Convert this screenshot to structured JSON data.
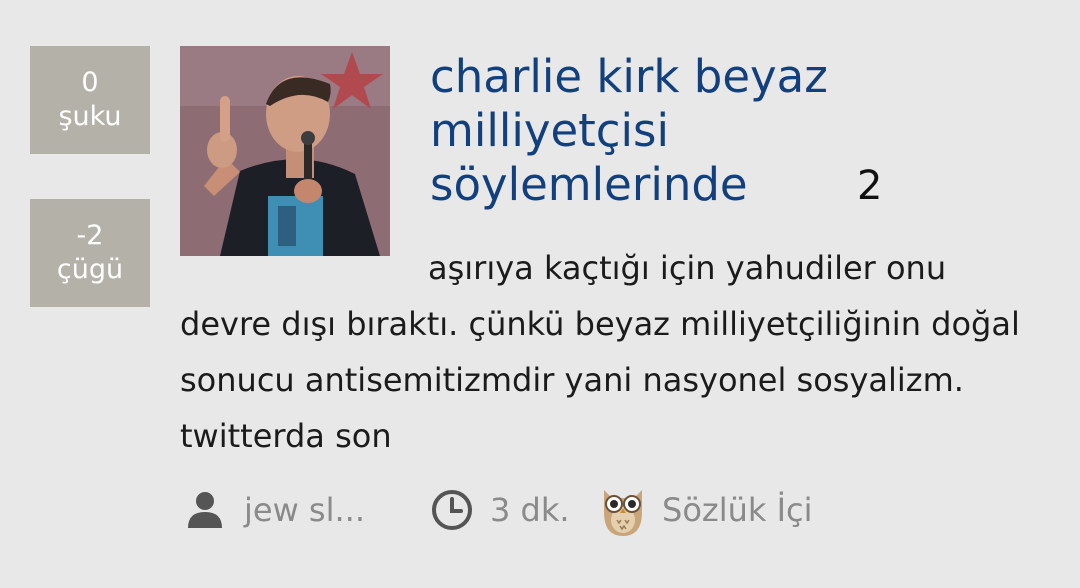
{
  "entry": {
    "title": "charlie kirk beyaz milliyetçisi söylemlerinde",
    "comment_count": "2",
    "excerpt": "aşırıya kaçtığı için yahudiler onu devre dışı bıraktı. çünkü beyaz milliyetçiliğinin doğal sonucu antisemitizmdir yani nasyonel sosyalizm. twitterda son"
  },
  "votes": {
    "up": {
      "count": "0",
      "label": "şuku"
    },
    "down": {
      "count": "-2",
      "label": "çügü"
    }
  },
  "meta": {
    "author": "jew sl...",
    "time": "3 dk.",
    "category": "Sözlük İçi"
  },
  "icons": {
    "author": "person-icon",
    "time": "clock-icon",
    "category": "owl-icon"
  },
  "colors": {
    "background": "#e8e8e8",
    "title": "#123f7e",
    "vote_box": "#b4b2a8",
    "meta_text": "#8a8a8a"
  }
}
